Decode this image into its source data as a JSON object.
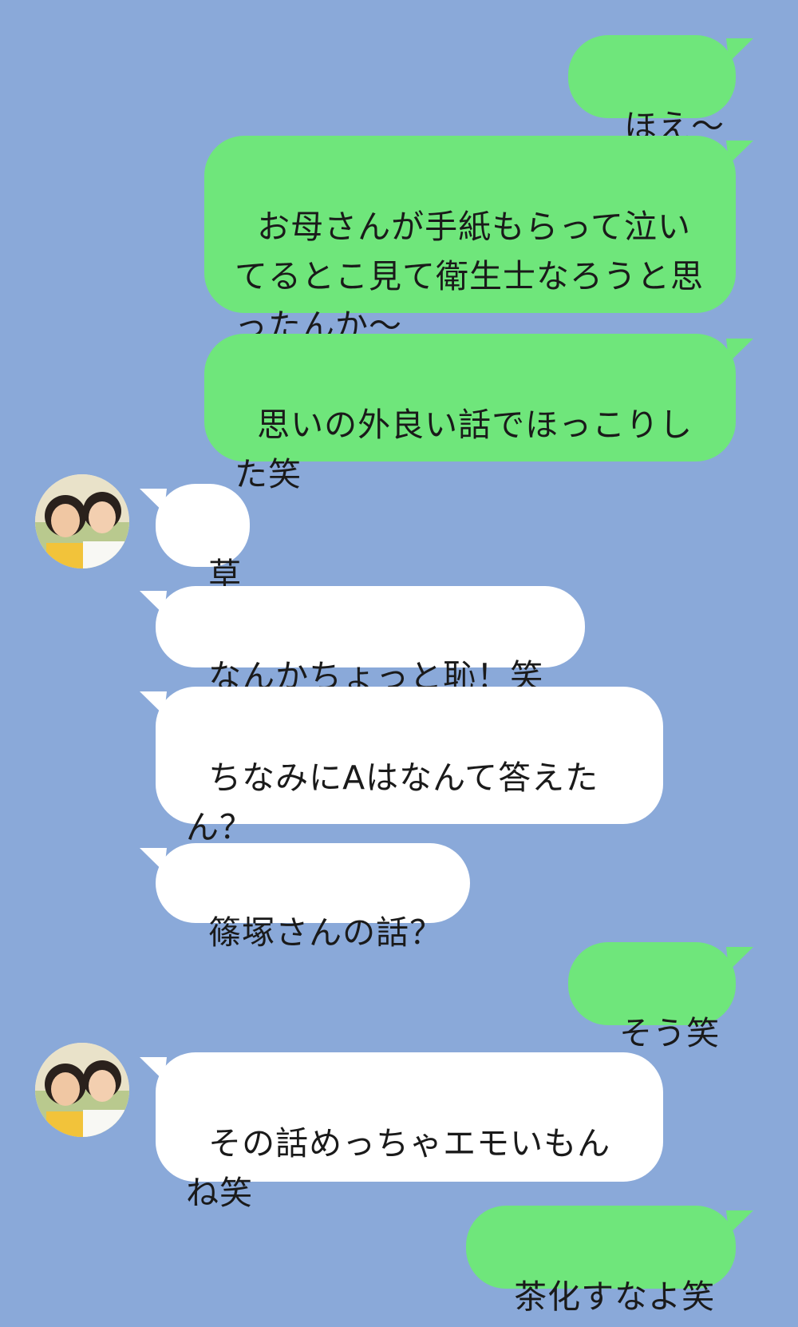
{
  "colors": {
    "background": "#8aa9d9",
    "sent_bubble": "#6fe67b",
    "received_bubble": "#ffffff"
  },
  "messages": [
    {
      "text": "ほえ〜"
    },
    {
      "text": "お母さんが手紙もらって泣いてるとこ見て衛生士なろうと思ったんか〜"
    },
    {
      "text": "思いの外良い話でほっこりした笑"
    },
    {
      "text": "草"
    },
    {
      "text": "なんかちょっと恥！笑"
    },
    {
      "text": "ちなみにAはなんて答えたん？"
    },
    {
      "text": "篠塚さんの話？"
    },
    {
      "text": "そう笑"
    },
    {
      "text": "その話めっちゃエモいもんね笑"
    },
    {
      "text": "茶化すなよ笑"
    }
  ],
  "avatar": {
    "icon": "profile-photo-two-women"
  }
}
